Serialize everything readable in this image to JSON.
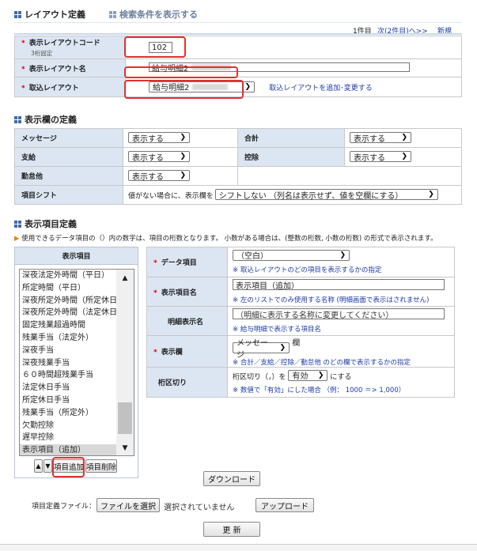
{
  "header": {
    "title": "レイアウト定義",
    "toggle_link": "検索条件を表示する"
  },
  "pager": {
    "count": "1件目",
    "next": "次(2件目)へ>>",
    "new": "新規"
  },
  "layout": {
    "code_label": "表示レイアウトコード",
    "code_note": "3桁固定",
    "code_value": "102",
    "name_label": "表示レイアウト名",
    "name_value": "給与明細2",
    "import_label": "取込レイアウト",
    "import_value": "給与明細2",
    "import_link": "取込レイアウトを追加･変更する"
  },
  "columns": {
    "title": "表示欄の定義",
    "message_label": "メッセージ",
    "message_value": "表示する",
    "total_label": "合計",
    "total_value": "表示する",
    "payment_label": "支給",
    "payment_value": "表示する",
    "deduction_label": "控除",
    "deduction_value": "表示する",
    "attendance_label": "勤怠他",
    "attendance_value": "表示する",
    "shift_label": "項目シフト",
    "shift_prefix": "値がない場合に、表示欄を",
    "shift_value": "シフトしない （列名は表示せず、値を空欄にする）"
  },
  "items": {
    "title": "表示項目定義",
    "note": "使用できるデータ項目の（）内の数字は、項目の桁数となります。 小数がある場合は、(整数の桁数, 小数の桁数) の形式で表示されます。",
    "list_header": "表示項目",
    "list": [
      "深夜法定外時間（平日）",
      "所定時間（平日）",
      "深夜所定外時間（所定休日）",
      "深夜所定外時間（法定休日）",
      "固定残業超過時間",
      "残業手当（法定外）",
      "深夜手当",
      "深夜残業手当",
      "６０時間超残業手当",
      "法定休日手当",
      "所定休日手当",
      "残業手当（所定外）",
      "欠勤控除",
      "遅早控除",
      "表示項目（追加）"
    ],
    "up_arrow": "▲",
    "down_arrow": "▼",
    "add_button": "項目追加",
    "delete_button": "項目削除",
    "data_item_label": "データ項目",
    "data_item_value": "（空白）",
    "data_item_hint": "※ 取込レイアウトのどの項目を表示するかの指定",
    "display_name_label": "表示項目名",
    "display_name_value": "表示項目（追加）",
    "display_name_hint": "※ 左のリストでのみ使用する名称 (明細画面で表示はされません)",
    "detail_name_label": "明細表示名",
    "detail_name_placeholder": "（明細に表示する名称に変更してください）",
    "detail_name_hint": "※ 給与明細で表示する項目名",
    "display_col_label": "表示欄",
    "display_col_value": "メッセージ",
    "display_col_suffix": "欄",
    "display_col_hint": "※ 合計／支給／控除／勤怠他 のどの欄で表示するかの指定",
    "digit_label": "桁区切り",
    "digit_prefix": "桁区切り（，）を",
    "digit_value": "有効",
    "digit_suffix": "にする",
    "digit_hint": "※ 数値で「有効」にした場合 （例： 1000 ＝> 1,000）"
  },
  "download_button": "ダウンロード",
  "file": {
    "label": "項目定義ファイル：",
    "choose_button": "ファイルを選択",
    "status": "選択されていません",
    "upload_button": "アップロード"
  },
  "update_button": "更 新",
  "colors": {
    "accent": "#3a6ab0",
    "label_bg": "#dce6f2",
    "highlight": "#e0302f",
    "link": "#1b3aa8"
  }
}
